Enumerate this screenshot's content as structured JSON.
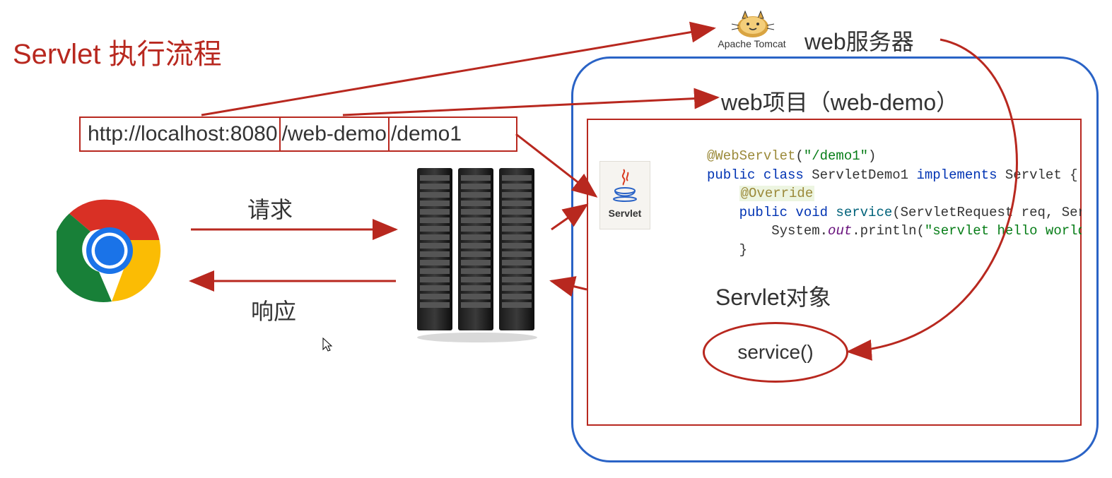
{
  "title": "Servlet 执行流程",
  "url": {
    "seg1": "http://localhost:8080",
    "seg2": "/web-demo",
    "seg3": "/demo1"
  },
  "labels": {
    "request": "请求",
    "response": "响应",
    "web_server": "web服务器",
    "web_project": "web项目（web-demo）",
    "servlet_obj": "Servlet对象",
    "service_method": "service()",
    "tomcat": "Apache Tomcat",
    "servlet_icon": "Servlet"
  },
  "code": {
    "annotation": "@WebServlet",
    "anno_arg": "\"/demo1\"",
    "line2_pre": "public class",
    "line2_cls": " ServletDemo1 ",
    "line2_impl": "implements",
    "line2_iface": " Servlet {",
    "override": "@Override",
    "line4_pre": "public void",
    "line4_fn": " service",
    "line4_args": "(ServletRequest req, ServletRe",
    "line5_pre": "System.",
    "line5_out": "out",
    "line5_print": ".println(",
    "line5_str": "\"servlet hello world~\"",
    "line5_end": ");",
    "line6": "}"
  }
}
